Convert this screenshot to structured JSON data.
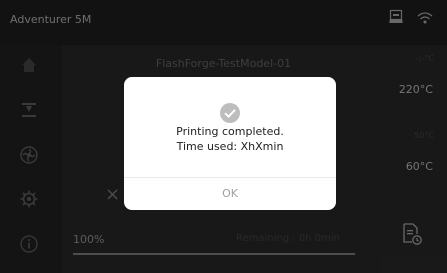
{
  "header": {
    "brand": "Adventurer 5M",
    "icons": [
      "printer-status-icon",
      "wifi-icon"
    ]
  },
  "sidebar": {
    "items": [
      {
        "name": "home",
        "icon": "home-icon"
      },
      {
        "name": "print",
        "icon": "nozzle-icon"
      },
      {
        "name": "fan",
        "icon": "fan-icon"
      },
      {
        "name": "settings",
        "icon": "gear-icon"
      },
      {
        "name": "info",
        "icon": "info-icon"
      }
    ]
  },
  "job": {
    "model_name": "FlashForge-TestModel-01",
    "nozzle_target": "-/-°C",
    "nozzle_temp": "220°C",
    "bed_target": "50°C",
    "bed_temp": "60°C",
    "progress_text": "100%",
    "progress": 1.0,
    "remaining": "Remaining : 0h 0min",
    "cancel_symbol": "×"
  },
  "dialog": {
    "line1": "Printing completed.",
    "line2": "Time used: XhXmin",
    "ok_label": "OK"
  },
  "colors": {
    "background": "#2d2d2d",
    "dialog": "#ffffff",
    "check": "#bdbdbd"
  }
}
